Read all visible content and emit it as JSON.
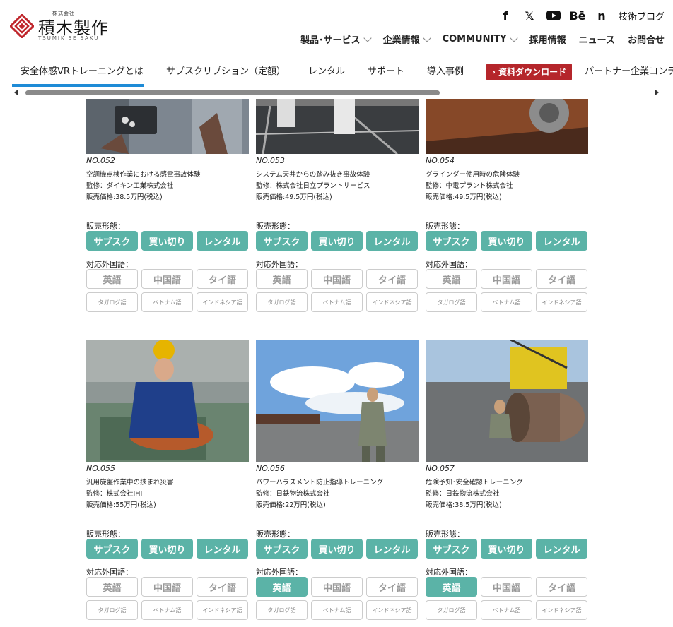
{
  "header": {
    "logo_small": "株式会社",
    "logo_main": "積木製作",
    "logo_sub": "TSUMIKISEISAKU",
    "social": [
      {
        "icon": "facebook-icon",
        "glyph": "f"
      },
      {
        "icon": "x-icon",
        "glyph": "𝕏"
      },
      {
        "icon": "youtube-icon",
        "glyph": "▶"
      },
      {
        "icon": "behance-icon",
        "glyph": "Bē"
      },
      {
        "icon": "note-icon",
        "glyph": "n"
      }
    ],
    "blog_label": "技術ブログ",
    "nav": [
      {
        "label": "製品･サービス",
        "dropdown": true
      },
      {
        "label": "企業情報",
        "dropdown": true
      },
      {
        "label": "COMMUNITY",
        "dropdown": true
      },
      {
        "label": "採用情報",
        "dropdown": false
      },
      {
        "label": "ニュース",
        "dropdown": false
      },
      {
        "label": "お問合せ",
        "dropdown": false
      }
    ]
  },
  "subnav": {
    "items": [
      "安全体感VRトレーニングとは",
      "サブスクリプション（定額）",
      "レンタル",
      "サポート",
      "導入事例"
    ],
    "download": "› 資料ダウンロード",
    "partner": "パートナー企業コンテンツ"
  },
  "labels": {
    "sales": "販売形態：",
    "lang": "対応外国語：",
    "buy": [
      "サブスク",
      "買い切り",
      "レンタル"
    ],
    "langs_big": [
      "英語",
      "中国語",
      "タイ語"
    ],
    "langs_small": [
      "タガログ語",
      "ベトナム語",
      "インドネシア語"
    ]
  },
  "colors": {
    "accent": "#5bb3a7",
    "download": "#b5262b",
    "active_bar": "#1e8bd6"
  },
  "cards": [
    {
      "no": "NO.052",
      "title": "空調機点検作業における感電事故体験",
      "supervisor": "監修：ダイキン工業株式会社",
      "price": "販売価格:38.5万円(税込)",
      "english": false
    },
    {
      "no": "NO.053",
      "title": "システム天井からの踏み抜き事故体験",
      "supervisor": "監修：株式会社日立プラントサービス",
      "price": "販売価格:49.5万円(税込)",
      "english": false
    },
    {
      "no": "NO.054",
      "title": "グラインダー使用時の危険体験",
      "supervisor": "監修：中電プラント株式会社",
      "price": "販売価格:49.5万円(税込)",
      "english": false
    },
    {
      "no": "NO.055",
      "title": "汎用旋盤作業中の挟まれ災害",
      "supervisor": "監修：株式会社IHI",
      "price": "販売価格:55万円(税込)",
      "english": false
    },
    {
      "no": "NO.056",
      "title": "パワーハラスメント防止指導トレーニング",
      "supervisor": "監修：日鉄物流株式会社",
      "price": "販売価格:22万円(税込)",
      "english": true
    },
    {
      "no": "NO.057",
      "title": "危険予知･安全確認トレーニング",
      "supervisor": "監修：日鉄物流株式会社",
      "price": "販売価格:38.5万円(税込)",
      "english": true
    }
  ]
}
